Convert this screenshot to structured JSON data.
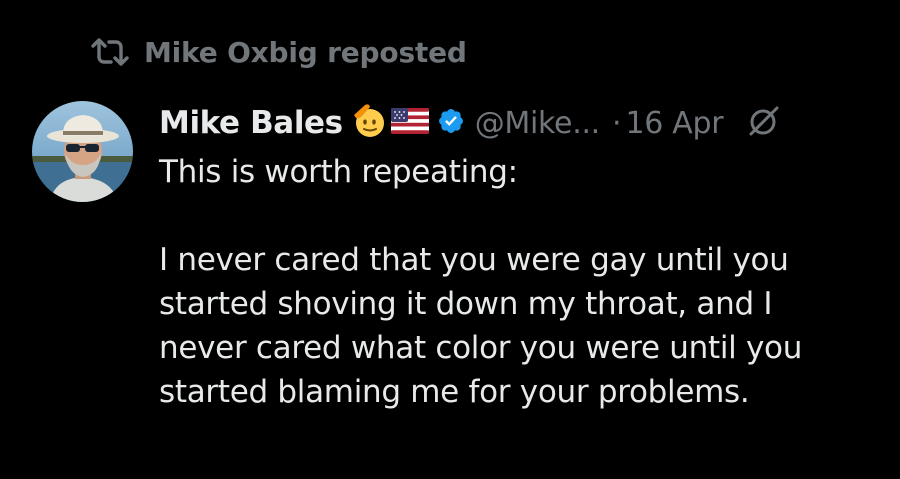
{
  "repost": {
    "icon": "repost-icon",
    "text": "Mike Oxbig reposted"
  },
  "author": {
    "avatar": "avatar",
    "display_name": "Mike Bales",
    "emojis": [
      "saluting-face-emoji",
      "us-flag-emoji"
    ],
    "verified_icon": "verified-badge-icon",
    "verified_color": "#1d9bf0",
    "handle": "@Mike...",
    "separator": "·",
    "date": "16 Apr",
    "action_icon": "grok-icon"
  },
  "tweet": {
    "line1": "This is worth repeating:",
    "paragraph": [
      "I never cared that you were gay until you",
      "started shoving it down my throat, and I",
      "never cared what color you were until you",
      "started blaming me for your problems."
    ]
  },
  "colors": {
    "background": "#000000",
    "text": "#e7e9ea",
    "muted": "#71767b"
  }
}
